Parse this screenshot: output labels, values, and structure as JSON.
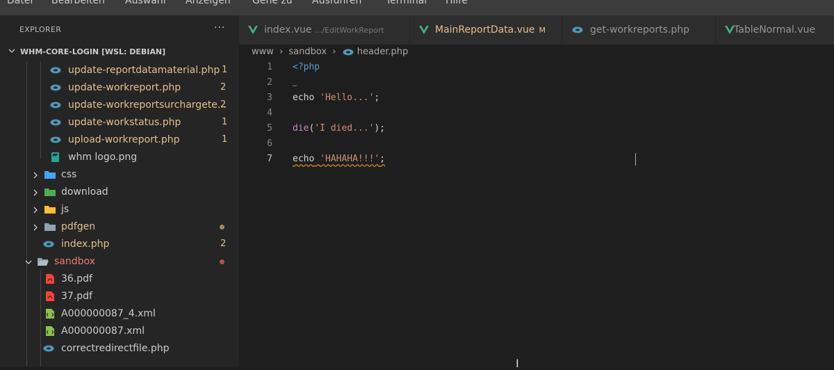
{
  "menu": {
    "items": [
      "Datei",
      "Bearbeiten",
      "Auswahl",
      "Anzeigen",
      "Gehe zu",
      "Ausführen",
      "Terminal",
      "Hilfe"
    ]
  },
  "explorer": {
    "title": "EXPLORER",
    "more": "···",
    "project": "WHM-CORE-LOGIN [WSL: DEBIAN]",
    "rows": [
      {
        "label": "update-reportdatamaterial.php",
        "icon": "php-icon",
        "badge": "1"
      },
      {
        "label": "update-workreport.php",
        "icon": "php-icon",
        "badge": "2"
      },
      {
        "label": "update-workreportsurchargete...",
        "icon": "php-icon",
        "badge": "2"
      },
      {
        "label": "update-workstatus.php",
        "icon": "php-icon",
        "badge": "1"
      },
      {
        "label": "upload-workreport.php",
        "icon": "php-icon",
        "badge": "1"
      },
      {
        "label": "whm logo.png",
        "icon": "image-icon",
        "badge": ""
      },
      {
        "label": "css",
        "icon": "folder-css-icon",
        "badge": ""
      },
      {
        "label": "download",
        "icon": "folder-download-icon",
        "badge": ""
      },
      {
        "label": "js",
        "icon": "folder-js-icon",
        "badge": ""
      },
      {
        "label": "pdfgen",
        "icon": "folder-icon",
        "badge": ""
      },
      {
        "label": "index.php",
        "icon": "php-icon",
        "badge": "2"
      },
      {
        "label": "sandbox",
        "icon": "folder-open-icon",
        "badge": ""
      },
      {
        "label": "36.pdf",
        "icon": "pdf-icon",
        "badge": ""
      },
      {
        "label": "37.pdf",
        "icon": "pdf-icon",
        "badge": ""
      },
      {
        "label": "A000000087_4.xml",
        "icon": "xml-icon",
        "badge": ""
      },
      {
        "label": "A000000087.xml",
        "icon": "xml-icon",
        "badge": ""
      },
      {
        "label": "correctredirectfile.php",
        "icon": "php-icon",
        "badge": ""
      }
    ]
  },
  "tabs": [
    {
      "label": "index.vue",
      "sub": ".../EditWorkReport",
      "modified": "",
      "icon": "vue-icon"
    },
    {
      "label": "MainReportData.vue",
      "sub": "",
      "modified": "M",
      "icon": "vue-icon"
    },
    {
      "label": "get-workreports.php",
      "sub": "",
      "modified": "",
      "icon": "php-icon"
    },
    {
      "label": "TableNormal.vue",
      "sub": "",
      "modified": "",
      "icon": "vue-icon"
    }
  ],
  "breadcrumb": {
    "parts": [
      "www",
      "sandbox",
      "header.php"
    ]
  },
  "editor": {
    "line_numbers": [
      "1",
      "2",
      "3",
      "4",
      "5",
      "6",
      "7"
    ],
    "lines": {
      "l1": "<?php",
      "l3_kw": "echo",
      "l3_str": "'Hello...'",
      "l3_end": ";",
      "l5_fn": "die",
      "l5_open": "(",
      "l5_str": "'I died...'",
      "l5_end": ");",
      "l7_kw": "echo",
      "l7_str": "'HAHAHA!!!'",
      "l7_end": ";"
    }
  },
  "colors": {
    "accent": "#007acc",
    "modified": "#e2c08d",
    "error": "#e67e73",
    "php": "#519aba",
    "vue": "#41b883"
  }
}
